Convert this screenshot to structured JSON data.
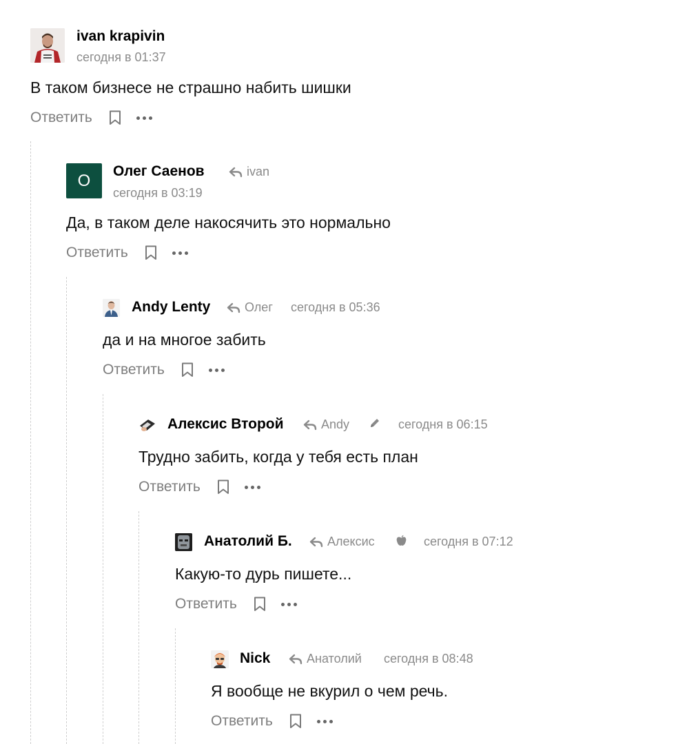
{
  "actions": {
    "reply": "Ответить"
  },
  "comments": [
    {
      "author": "ivan krapivin",
      "time": "сегодня в 01:37",
      "text": "В таком бизнесе не страшно набить шишки",
      "avatar": "photo-avatar"
    },
    {
      "author": "Олег Саенов",
      "reply_to": "ivan",
      "time": "сегодня в 03:19",
      "text": "Да, в таком деле накосячить это нормально",
      "avatar_letter": "О",
      "avatar_color": "#0d4f3f"
    },
    {
      "author": "Andy Lenty",
      "reply_to": "Олег",
      "time": "сегодня в 05:36",
      "text": "да и на многое забить",
      "avatar": "person-avatar"
    },
    {
      "author": "Алексис Второй",
      "reply_to": "Andy",
      "edited_icon": "pencil-icon",
      "time": "сегодня в 06:15",
      "text": "Трудно забить, когда у тебя есть план",
      "avatar": "hand-avatar"
    },
    {
      "author": "Анатолий Б.",
      "reply_to": "Алексис",
      "platform_icon": "apple-icon",
      "time": "сегодня в 07:12",
      "text": "Какую-то дурь пишете...",
      "avatar": "robot-avatar"
    },
    {
      "author": "Nick",
      "reply_to": "Анатолий",
      "time": "сегодня в 08:48",
      "text": "Я вообще не вкурил о чем речь.",
      "avatar": "cartoon-avatar"
    }
  ]
}
